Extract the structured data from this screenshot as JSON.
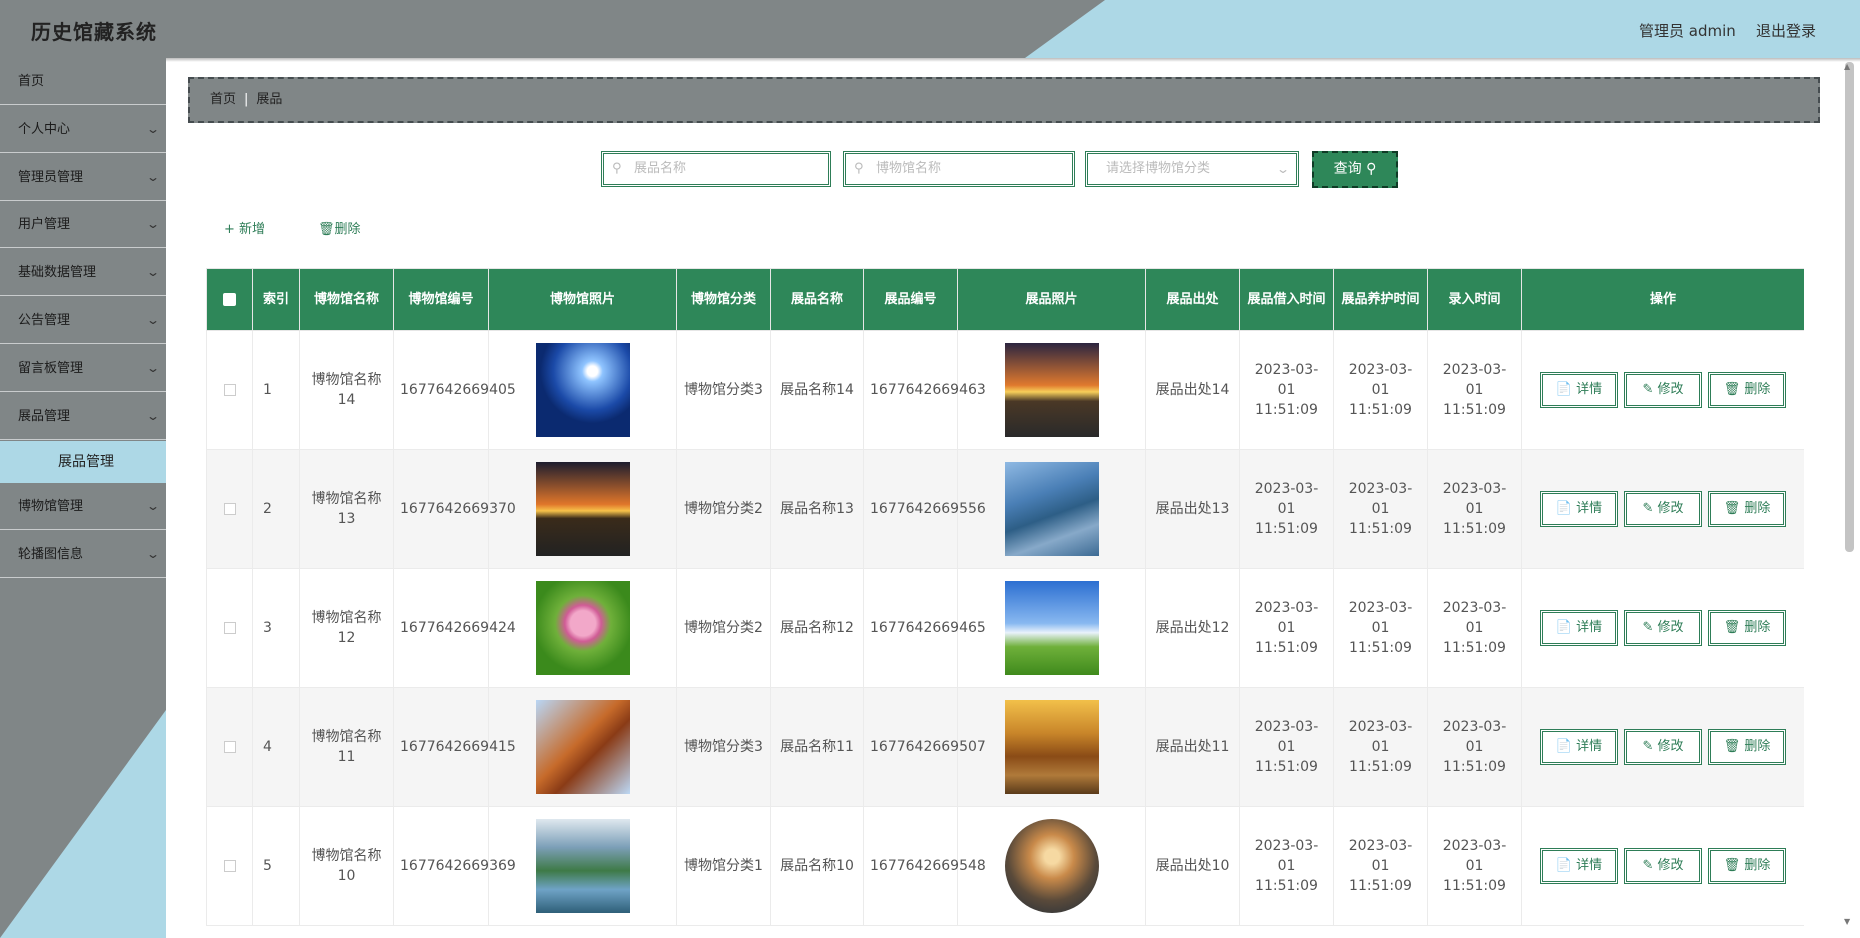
{
  "app": {
    "title": "历史馆藏系统",
    "user_label": "管理员 admin",
    "logout_label": "退出登录"
  },
  "sidebar": {
    "items": [
      {
        "label": "首页",
        "has_arrow": false
      },
      {
        "label": "个人中心",
        "has_arrow": true
      },
      {
        "label": "管理员管理",
        "has_arrow": true
      },
      {
        "label": "用户管理",
        "has_arrow": true
      },
      {
        "label": "基础数据管理",
        "has_arrow": true
      },
      {
        "label": "公告管理",
        "has_arrow": true
      },
      {
        "label": "留言板管理",
        "has_arrow": true
      },
      {
        "label": "展品管理",
        "has_arrow": true
      }
    ],
    "sub_item": "展品管理",
    "items_after": [
      {
        "label": "博物馆管理",
        "has_arrow": true
      },
      {
        "label": "轮播图信息",
        "has_arrow": true
      }
    ]
  },
  "breadcrumb": {
    "home": "首页",
    "sep": "|",
    "current": "展品"
  },
  "search": {
    "name_placeholder": "展品名称",
    "museum_placeholder": "博物馆名称",
    "category_placeholder": "请选择博物馆分类",
    "query_label": "查询"
  },
  "actions": {
    "add_label": "新增",
    "delete_label": "删除"
  },
  "table": {
    "headers": [
      "索引",
      "博物馆名称",
      "博物馆编号",
      "博物馆照片",
      "博物馆分类",
      "展品名称",
      "展品编号",
      "展品照片",
      "展品出处",
      "展品借入时间",
      "展品养护时间",
      "录入时间",
      "操作"
    ],
    "op_labels": {
      "detail": "详情",
      "edit": "修改",
      "delete": "删除"
    },
    "rows": [
      {
        "index": "1",
        "museum_name": "博物馆名称14",
        "museum_no": "1677642669405",
        "category": "博物馆分类3",
        "exhibit_name": "展品名称14",
        "exhibit_no": "1677642669463",
        "source": "展品出处14",
        "borrow_time": "2023-03-01 11:51:09",
        "care_time": "2023-03-01 11:51:09",
        "entry_time": "2023-03-01 11:51:09"
      },
      {
        "index": "2",
        "museum_name": "博物馆名称13",
        "museum_no": "1677642669370",
        "category": "博物馆分类2",
        "exhibit_name": "展品名称13",
        "exhibit_no": "1677642669556",
        "source": "展品出处13",
        "borrow_time": "2023-03-01 11:51:09",
        "care_time": "2023-03-01 11:51:09",
        "entry_time": "2023-03-01 11:51:09"
      },
      {
        "index": "3",
        "museum_name": "博物馆名称12",
        "museum_no": "1677642669424",
        "category": "博物馆分类2",
        "exhibit_name": "展品名称12",
        "exhibit_no": "1677642669465",
        "source": "展品出处12",
        "borrow_time": "2023-03-01 11:51:09",
        "care_time": "2023-03-01 11:51:09",
        "entry_time": "2023-03-01 11:51:09"
      },
      {
        "index": "4",
        "museum_name": "博物馆名称11",
        "museum_no": "1677642669415",
        "category": "博物馆分类3",
        "exhibit_name": "展品名称11",
        "exhibit_no": "1677642669507",
        "source": "展品出处11",
        "borrow_time": "2023-03-01 11:51:09",
        "care_time": "2023-03-01 11:51:09",
        "entry_time": "2023-03-01 11:51:09"
      },
      {
        "index": "5",
        "museum_name": "博物馆名称10",
        "museum_no": "1677642669369",
        "category": "博物馆分类1",
        "exhibit_name": "展品名称10",
        "exhibit_no": "1677642669548",
        "source": "展品出处10",
        "borrow_time": "2023-03-01 11:51:09",
        "care_time": "2023-03-01 11:51:09",
        "entry_time": "2023-03-01 11:51:09"
      }
    ]
  },
  "colors": {
    "primary": "#2e8759",
    "header_bg": "#808687",
    "accent_light": "#add8e6"
  }
}
